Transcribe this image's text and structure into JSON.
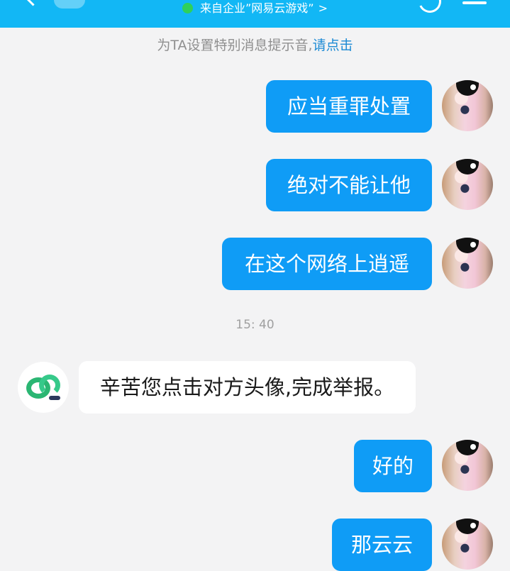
{
  "header": {
    "subtitle": "来自企业”网易云游戏”",
    "subtitle_chevron": ">"
  },
  "hint": {
    "text": "为TA设置特别消息提示音,",
    "link": "请点击"
  },
  "messages": [
    {
      "sender": "me",
      "text": "应当重罪处置"
    },
    {
      "sender": "me",
      "text": "绝对不能让他"
    },
    {
      "sender": "me",
      "text": "在这个网络上逍遥"
    },
    {
      "sender": "them",
      "text": "辛苦您点击对方头像,完成举报。"
    },
    {
      "sender": "me",
      "text": "好的"
    },
    {
      "sender": "me",
      "text": "那云云"
    }
  ],
  "timestamp": "15: 40",
  "colors": {
    "header": "#12b7f5",
    "my_bubble": "#0f9cf6",
    "their_bubble": "#ffffff",
    "link": "#1c8ad4",
    "online_dot": "#2fd05a",
    "background": "#f3f3f4"
  },
  "icons": [
    "back-icon",
    "call-icon",
    "menu-icon",
    "status-dot-icon"
  ]
}
